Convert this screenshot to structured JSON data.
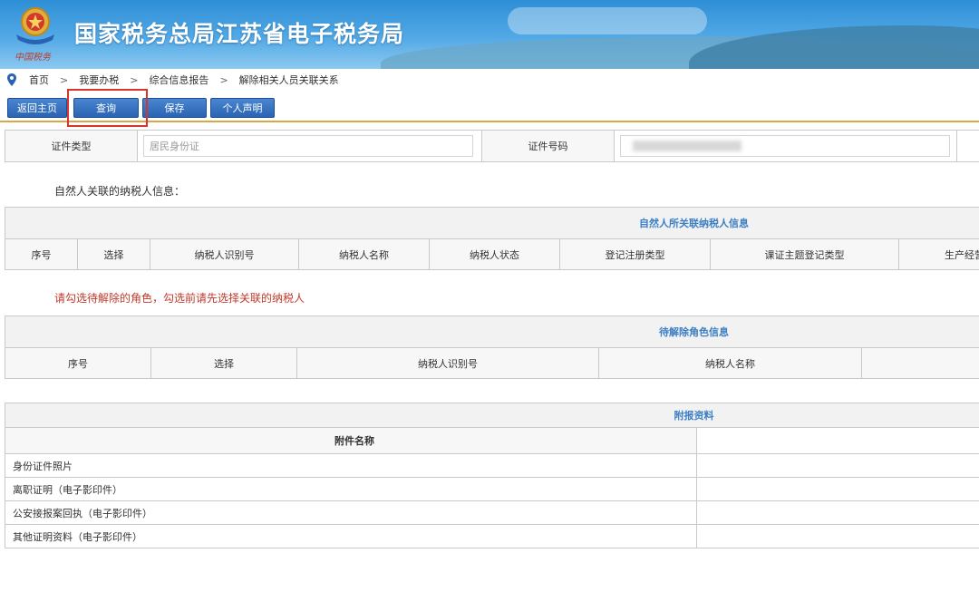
{
  "header": {
    "title": "国家税务总局江苏省电子税务局",
    "emblem_caption": "中国税务",
    "colors": {
      "banner": "#2e8fd6",
      "title": "#ffffff"
    }
  },
  "breadcrumb": {
    "items": [
      "首页",
      "我要办税",
      "综合信息报告",
      "解除相关人员关联关系"
    ],
    "separator": ">"
  },
  "toolbar": {
    "buttons": [
      "返回主页",
      "查询",
      "保存",
      "个人声明"
    ],
    "accent_color": "#2a63b3",
    "highlight_color": "#d9342b"
  },
  "id_row": {
    "type_label": "证件类型",
    "type_value": "居民身份证",
    "number_label": "证件号码",
    "number_value": ""
  },
  "related_section": {
    "title": "自然人关联的纳税人信息：",
    "caption": "自然人所关联纳税人信息",
    "columns": [
      "序号",
      "选择",
      "纳税人识别号",
      "纳税人名称",
      "纳税人状态",
      "登记注册类型",
      "课证主题登记类型",
      "生产经营"
    ]
  },
  "warning": "请勾选待解除的角色，勾选前请先选择关联的纳税人",
  "pending_section": {
    "caption": "待解除角色信息",
    "columns": [
      "序号",
      "选择",
      "纳税人识别号",
      "纳税人名称"
    ]
  },
  "attachments": {
    "caption": "附报资料",
    "header": "附件名称",
    "rows": [
      "身份证件照片",
      "离职证明（电子影印件）",
      "公安接报案回执（电子影印件）",
      "其他证明资料（电子影印件）"
    ]
  }
}
